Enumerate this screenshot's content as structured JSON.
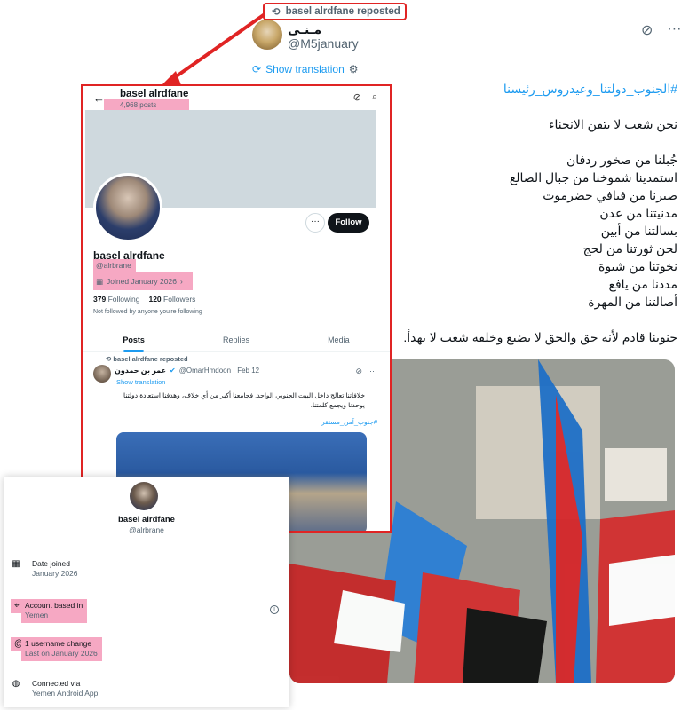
{
  "repost_banner": {
    "text": "basel alrdfane reposted"
  },
  "tweet": {
    "author_name": "مـنـى",
    "author_handle": "@M5january",
    "show_translation": "Show translation",
    "hashtag": "#الجنوب_دولتنا_وعيدروس_رئيسنا",
    "lines": [
      "نحن شعب لا يتقن الانحناء",
      "جُبلنا من صخور ردفان",
      "استمدينا شموخنا من جبال الضالع",
      "صبرنا من فيافي حضرموت",
      "مدنيتنا من عدن",
      "بسالتنا من أبين",
      "لحن ثورتنا من لحج",
      "نخوتنا من شبوة",
      "مددنا من يافع",
      "أصالتنا من المهرة"
    ],
    "closing": "جنوبنا قادم لأنه حق والحق لا يضيع وخلفه شعب لا يهدأ."
  },
  "profile": {
    "title": "basel alrdfane",
    "posts": "4,968 posts",
    "follow_label": "Follow",
    "name": "basel alrdfane",
    "handle": "@alrbrane",
    "joined": "Joined January 2026",
    "following_count": "379",
    "following_label": "Following",
    "followers_count": "120",
    "followers_label": "Followers",
    "not_followed": "Not followed by anyone you're following",
    "tabs": [
      "Posts",
      "Replies",
      "Media"
    ],
    "post": {
      "reposted": "basel alrdfane reposted",
      "author": "عمر بن حمدون",
      "handle_date": "@OmarHmdoon · Feb 12",
      "show_translation": "Show translation",
      "text": "خلافاتنا تعالج داخل البيت الجنوبي الواحد. فجامعنا أكبر من أي خلاف، وهدفنا استعادة دولتنا يوحدنا ويجمع كلمتنا.",
      "hashtag": "#جنوب_آمن_مستقر"
    }
  },
  "about": {
    "name": "basel alrdfane",
    "handle": "@alrbrane",
    "rows": [
      {
        "title": "Date joined",
        "sub": "January 2026",
        "icon": "calendar-icon"
      },
      {
        "title": "Account based in",
        "sub": "Yemen",
        "icon": "location-icon"
      },
      {
        "title": "1 username change",
        "sub": "Last on January 2026",
        "icon": "at-icon"
      },
      {
        "title": "Connected via",
        "sub": "Yemen Android App",
        "icon": "globe-icon"
      }
    ]
  },
  "colors": {
    "accent": "#1d9bf0",
    "highlight": "#f6a8c3",
    "annotation": "#e02424"
  }
}
